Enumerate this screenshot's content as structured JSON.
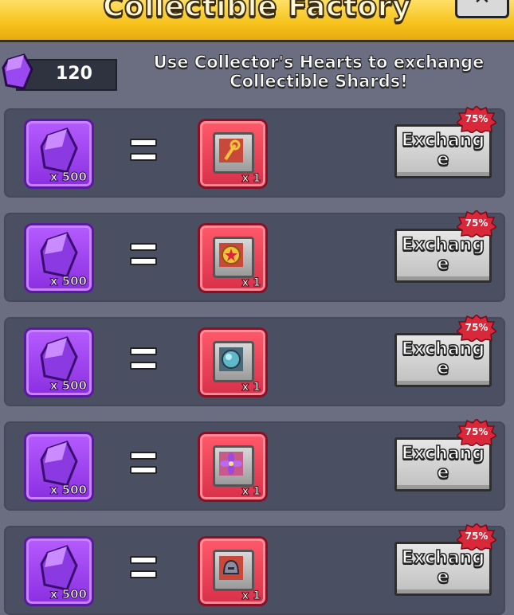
{
  "header": {
    "title": "Collectible Factory",
    "close_icon": "close-icon"
  },
  "currency": {
    "icon": "collectors-heart-gem-icon",
    "amount": "120"
  },
  "instruction": {
    "line1": "Use Collector's Hearts to exchange",
    "line2": "Collectible Shards!"
  },
  "rows": [
    {
      "cost_qty": "x 500",
      "reward_icon": "staff-shard-icon",
      "reward_qty": "x 1",
      "button_line1": "Exchang",
      "button_line2": "e",
      "discount": "75%"
    },
    {
      "cost_qty": "x 500",
      "reward_icon": "star-coin-shard-icon",
      "reward_qty": "x 1",
      "button_line1": "Exchang",
      "button_line2": "e",
      "discount": "75%"
    },
    {
      "cost_qty": "x 500",
      "reward_icon": "orb-shard-icon",
      "reward_qty": "x 1",
      "button_line1": "Exchang",
      "button_line2": "e",
      "discount": "75%"
    },
    {
      "cost_qty": "x 500",
      "reward_icon": "flower-shard-icon",
      "reward_qty": "x 1",
      "button_line1": "Exchang",
      "button_line2": "e",
      "discount": "75%"
    },
    {
      "cost_qty": "x 500",
      "reward_icon": "helmet-shard-icon",
      "reward_qty": "x 1",
      "button_line1": "Exchang",
      "button_line2": "e",
      "discount": "75%"
    }
  ],
  "colors": {
    "gem_tile": "#9b3cf0",
    "shard_tile": "#e8404f",
    "title_bar": "#f6c21a",
    "discount_badge": "#d8283a"
  }
}
